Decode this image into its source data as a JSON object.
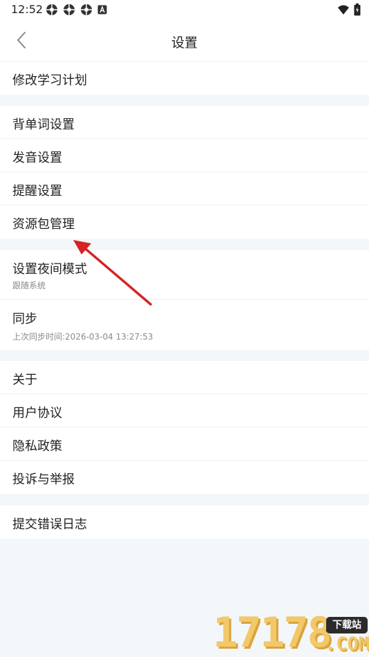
{
  "status_bar": {
    "time": "12:52",
    "notification_icons": [
      "notif-icon",
      "notif-icon",
      "notif-icon",
      "app-a-icon"
    ],
    "right_icons": [
      "wifi-icon",
      "battery-icon"
    ]
  },
  "header": {
    "title": "设置",
    "back_icon": "chevron-left-icon"
  },
  "groups": [
    {
      "items": [
        {
          "label": "修改学习计划"
        }
      ]
    },
    {
      "items": [
        {
          "label": "背单词设置"
        },
        {
          "label": "发音设置"
        },
        {
          "label": "提醒设置"
        },
        {
          "label": "资源包管理"
        }
      ]
    },
    {
      "items": [
        {
          "label": "设置夜间模式",
          "sub": "跟随系统"
        },
        {
          "label": "同步",
          "sub": "上次同步时间:2026-03-04 13:27:53"
        }
      ]
    },
    {
      "items": [
        {
          "label": "关于"
        },
        {
          "label": "用户协议"
        },
        {
          "label": "隐私政策"
        },
        {
          "label": "投诉与举报"
        }
      ]
    },
    {
      "items": [
        {
          "label": "提交错误日志"
        }
      ]
    }
  ],
  "annotation": {
    "color": "#d62323"
  },
  "watermark": {
    "number": "17178",
    "domain": ".COM",
    "tag": "下载站"
  },
  "colors": {
    "background": "#f4f7fa",
    "surface": "#ffffff",
    "text": "#222222",
    "subtext": "#8a8a8a"
  }
}
